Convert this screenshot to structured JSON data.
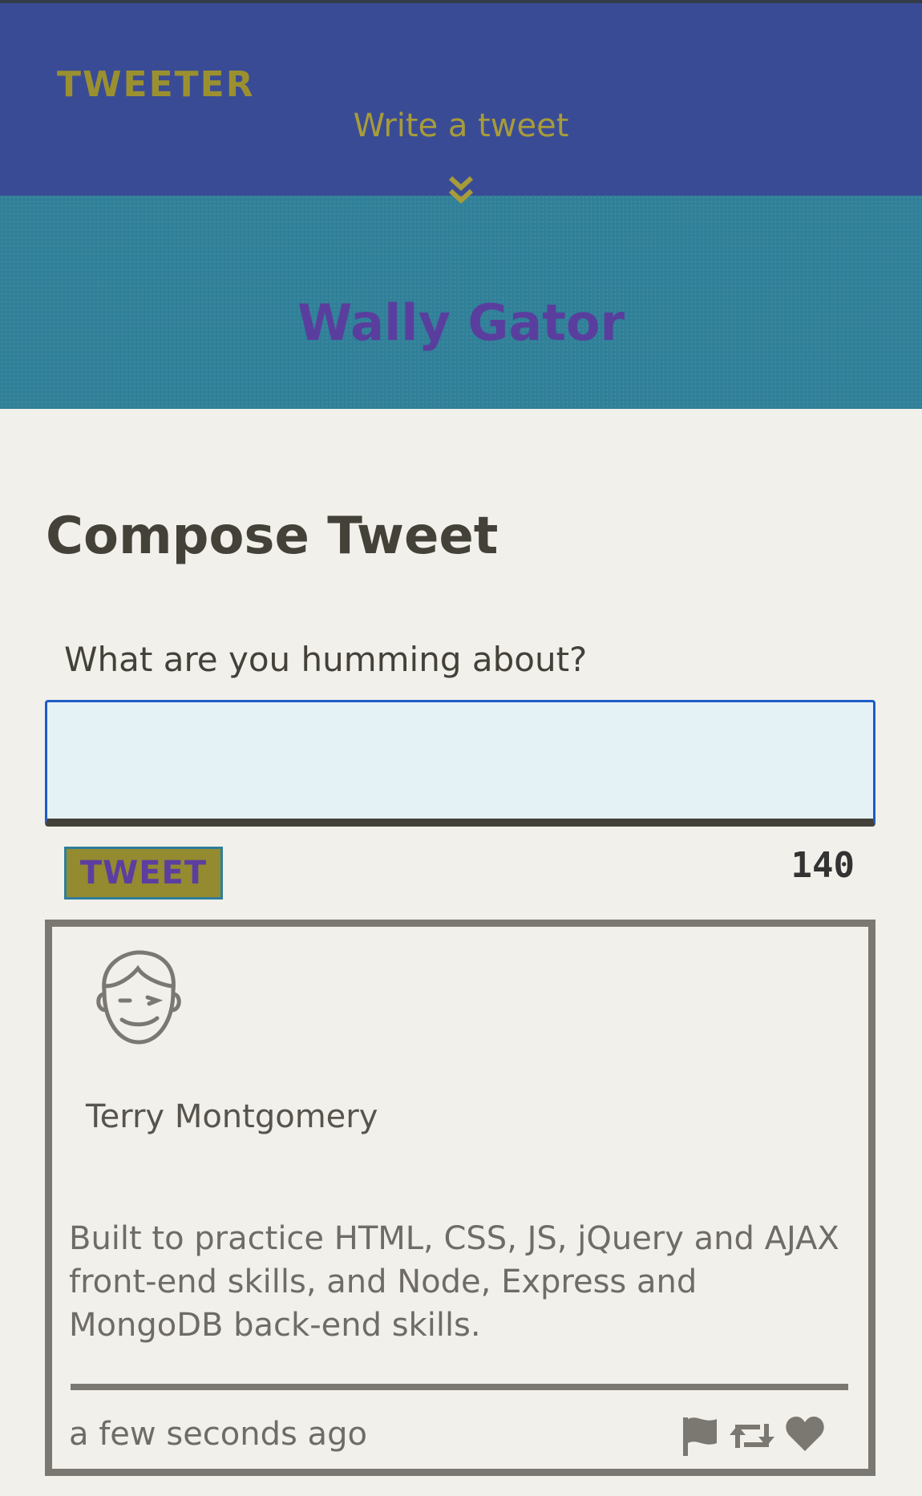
{
  "nav": {
    "brand": "TWEETER",
    "write_tweet": "Write a tweet",
    "toggle_icon": "double-chevron-down-icon"
  },
  "profile": {
    "name": "Wally Gator"
  },
  "compose": {
    "title": "Compose Tweet",
    "label": "What are you humming about?",
    "input_value": "",
    "button_label": "TWEET",
    "counter": "140"
  },
  "tweets": [
    {
      "avatar_icon": "face-avatar-icon",
      "author": "Terry Montgomery",
      "body": "Built to practice HTML, CSS, JS, jQuery and AJAX front-end skills, and Node, Express and MongoDB back-end skills.",
      "time": "a few seconds ago",
      "actions": [
        "flag-icon",
        "retweet-icon",
        "heart-icon"
      ]
    }
  ],
  "colors": {
    "nav_bg": "#3a4b95",
    "hero_bg": "#2f8098",
    "accent": "#9b9030",
    "name_color": "#5a3e9e",
    "page_bg": "#f2f0eb"
  }
}
